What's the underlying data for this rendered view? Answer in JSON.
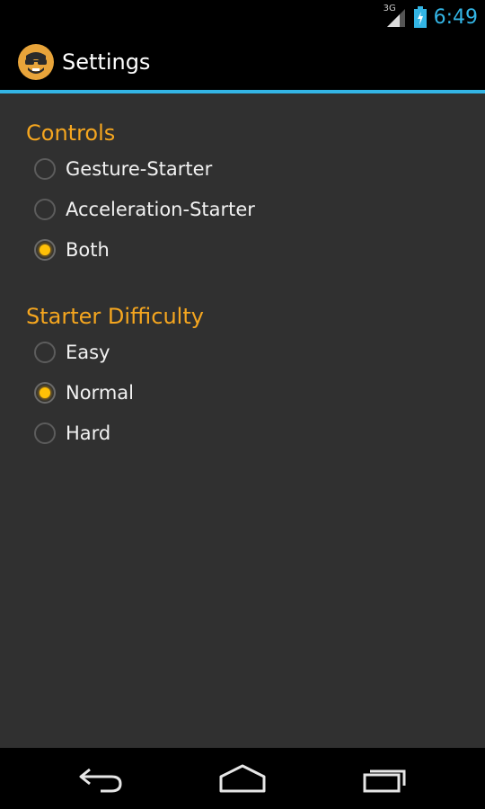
{
  "status": {
    "network_label": "3G",
    "time": "6:49",
    "accent_color": "#33b5e5"
  },
  "action_bar": {
    "title": "Settings",
    "icon": "app-logo-icon"
  },
  "sections": [
    {
      "header": "Controls",
      "options": [
        {
          "label": "Gesture-Starter",
          "checked": false
        },
        {
          "label": "Acceleration-Starter",
          "checked": false
        },
        {
          "label": "Both",
          "checked": true
        }
      ]
    },
    {
      "header": "Starter Difficulty",
      "options": [
        {
          "label": "Easy",
          "checked": false
        },
        {
          "label": "Normal",
          "checked": true
        },
        {
          "label": "Hard",
          "checked": false
        }
      ]
    }
  ],
  "nav": {
    "buttons": [
      "back-icon",
      "home-icon",
      "recent-apps-icon"
    ]
  },
  "colors": {
    "section_header": "#f5a61f",
    "radio_selected": "#ffc107",
    "background": "#303030"
  }
}
